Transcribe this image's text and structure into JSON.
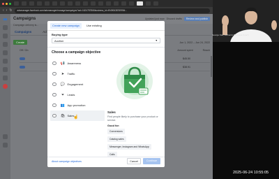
{
  "browser": {
    "url": "adsmanager.facebook.com/adsmanager/manage/campaigns?act=1624787866business_id=4949063876999#..."
  },
  "app": {
    "header_title": "Campaigns",
    "status_text": "Updated just now",
    "discard_label": "Discard drafts",
    "review_label": "Review and publish",
    "subheader": "Campaign delivery is...",
    "tabs": [
      "Campaigns",
      "Ad sets",
      "Ads"
    ],
    "create_label": "Create",
    "date_range": "Jun 1, 2022 – Jun 24, 2022",
    "col_offon": "Off / On",
    "col_spent": "Amount spent",
    "col_reach": "Reach",
    "row_spends": [
      "$45.50",
      "$38.91"
    ]
  },
  "modal": {
    "tab_new": "Create new campaign",
    "tab_existing": "Use existing",
    "buying_type_label": "Buying type",
    "buying_type_value": "Auction",
    "objective_heading": "Choose a campaign objective",
    "objectives": [
      {
        "label": "Awareness",
        "icon": "megaphone-icon",
        "glyph": "📢"
      },
      {
        "label": "Traffic",
        "icon": "cursor-icon",
        "glyph": "➤"
      },
      {
        "label": "Engagement",
        "icon": "chat-icon",
        "glyph": "💬"
      },
      {
        "label": "Leads",
        "icon": "filter-icon",
        "glyph": "⏷"
      },
      {
        "label": "App promotion",
        "icon": "people-icon",
        "glyph": "👥"
      },
      {
        "label": "Sales",
        "icon": "shopping-bag-icon",
        "glyph": "🛍"
      }
    ],
    "selected_objective": "Sales",
    "detail_title": "Sales",
    "detail_desc": "Find people likely to purchase your product or service.",
    "good_for_label": "Good for:",
    "good_for": [
      "Conversions",
      "Catalog sales",
      "Messenger, Instagram and WhatsApp",
      "Calls"
    ],
    "about_link": "About campaign objectives",
    "cancel_label": "Cancel",
    "continue_label": "Continue"
  },
  "webcam": {
    "name_label": "George Kao, Authentic Business Coach"
  },
  "timestamp": "2025-06-24  10:55:05",
  "colors": {
    "accent": "#1b64d8",
    "illustration": "#43a35a"
  }
}
